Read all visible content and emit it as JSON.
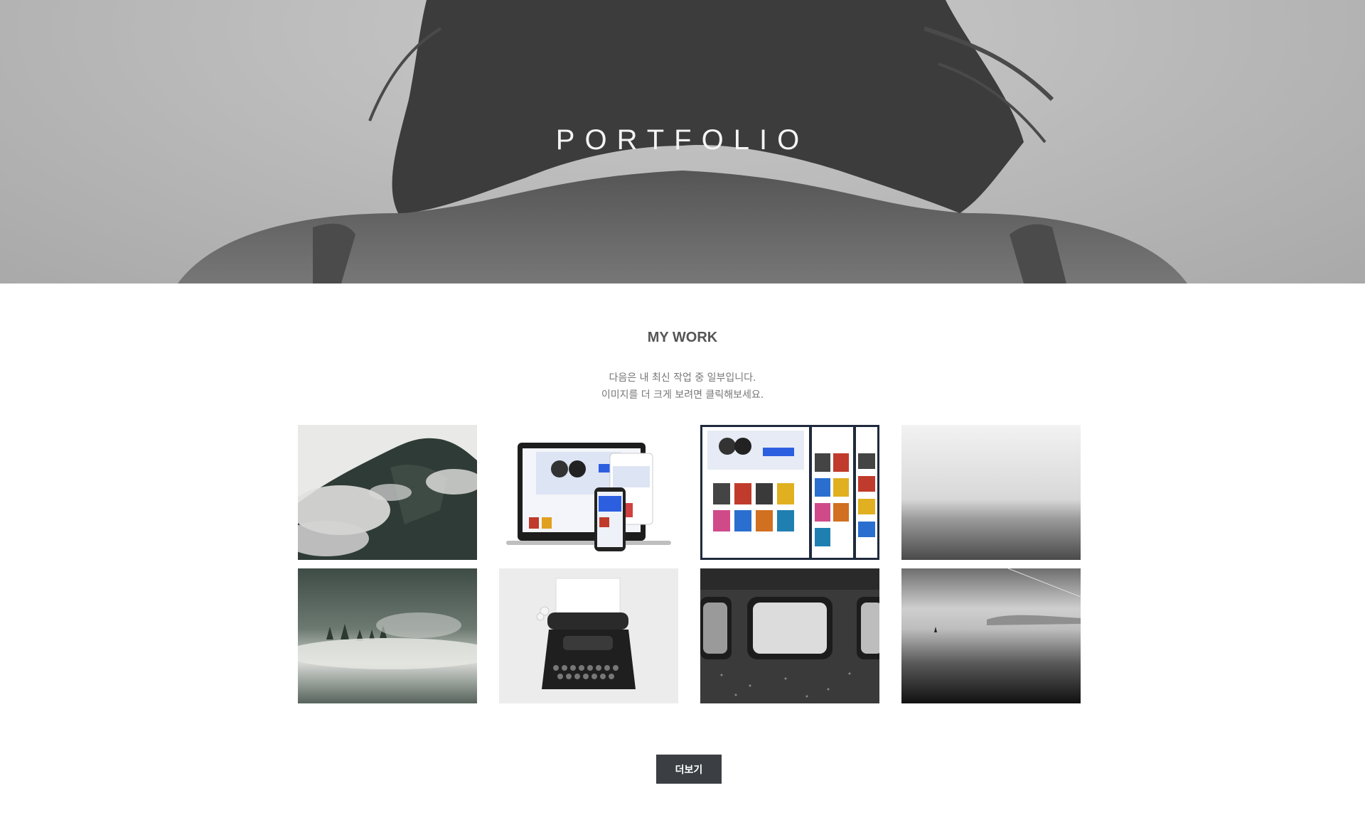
{
  "hero": {
    "title": "PORTFOLIO"
  },
  "work": {
    "heading": "MY WORK",
    "description_line1": "다음은 내 최신 작업 중 일부입니다.",
    "description_line2": "이미지를 더 크게 보려면 클릭해보세요."
  },
  "gallery": [
    {
      "subject": "misty-mountain"
    },
    {
      "subject": "responsive-web-mockup"
    },
    {
      "subject": "website-layout-screens"
    },
    {
      "subject": "foggy-sea"
    },
    {
      "subject": "forest-fog"
    },
    {
      "subject": "typewriter"
    },
    {
      "subject": "train-windows"
    },
    {
      "subject": "sea-with-boat"
    }
  ],
  "more_button": {
    "label": "더보기"
  },
  "colors": {
    "button_bg": "#3b3f44",
    "button_text": "#ffffff",
    "heading_text": "#555555",
    "hero_title": "#f4f4f4"
  }
}
